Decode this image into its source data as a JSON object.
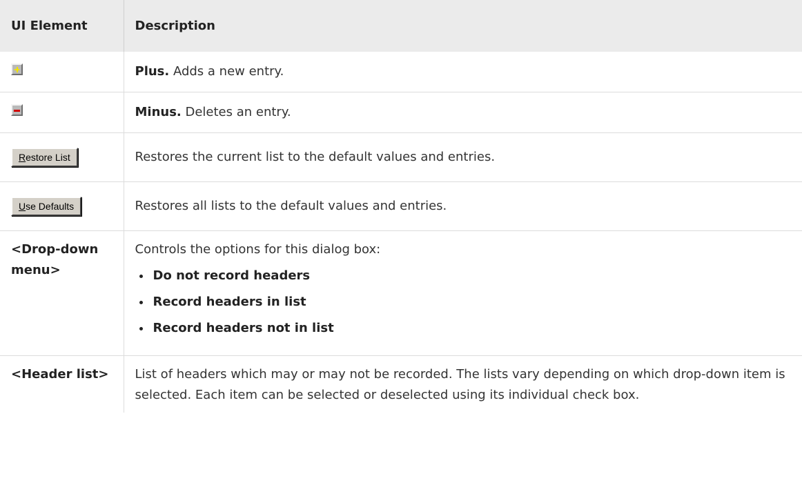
{
  "header": {
    "col1": "UI Element",
    "col2": "Description"
  },
  "rows": {
    "plus": {
      "icon": "plus-icon",
      "label": "Plus.",
      "desc": " Adds a new entry."
    },
    "minus": {
      "icon": "minus-icon",
      "label": "Minus.",
      "desc": " Deletes an entry."
    },
    "restore": {
      "prefix_underlined": "R",
      "rest": "estore List",
      "desc": "Restores the current list to the default values and entries."
    },
    "defaults": {
      "prefix_underlined": "U",
      "rest": "se Defaults",
      "desc": "Restores all lists to the default values and entries."
    },
    "dropdown": {
      "label": "<Drop-down menu>",
      "intro": "Controls the options for this dialog box:",
      "options": [
        "Do not record headers",
        "Record headers in list",
        "Record headers not in list"
      ]
    },
    "headerlist": {
      "label": "<Header list>",
      "desc": "List of headers which may or may not be recorded. The lists vary depending on which drop-down item is selected. Each item can be selected or deselected using its individual check box."
    }
  },
  "colors": {
    "header_bg": "#ebebeb",
    "plus": "#f2e400",
    "minus": "#d10000",
    "button_face": "#d4d0c8"
  }
}
